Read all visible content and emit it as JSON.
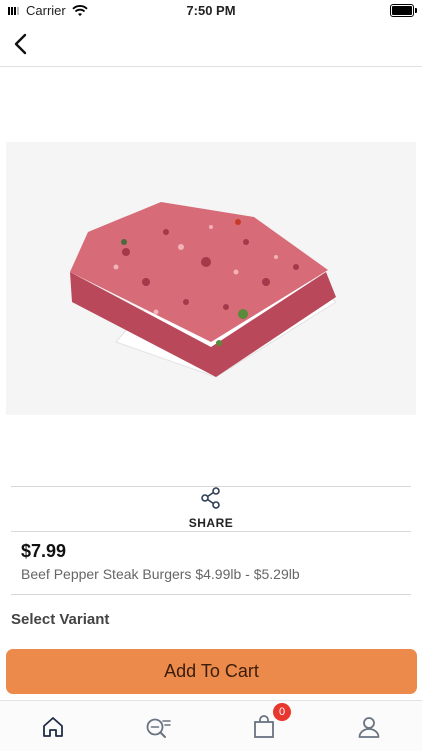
{
  "status_bar": {
    "carrier": "Carrier",
    "time": "7:50 PM"
  },
  "navigation": {
    "back_icon": "chevron-left-icon"
  },
  "product": {
    "image_icon": "product-photo",
    "share_label": "SHARE",
    "price": "$7.99",
    "description": "Beef Pepper Steak Burgers  $4.99lb - $5.29lb",
    "variant_title": "Select Variant"
  },
  "actions": {
    "add_to_cart_label": "Add To Cart"
  },
  "tab_bar": {
    "items": [
      {
        "name": "home",
        "icon": "home-icon"
      },
      {
        "name": "search",
        "icon": "search-icon"
      },
      {
        "name": "cart",
        "icon": "bag-icon",
        "badge": "0"
      },
      {
        "name": "account",
        "icon": "user-icon"
      }
    ]
  },
  "colors": {
    "accent": "#ec8a4b",
    "badge": "#e8372f",
    "icon": "#2f3e57"
  }
}
